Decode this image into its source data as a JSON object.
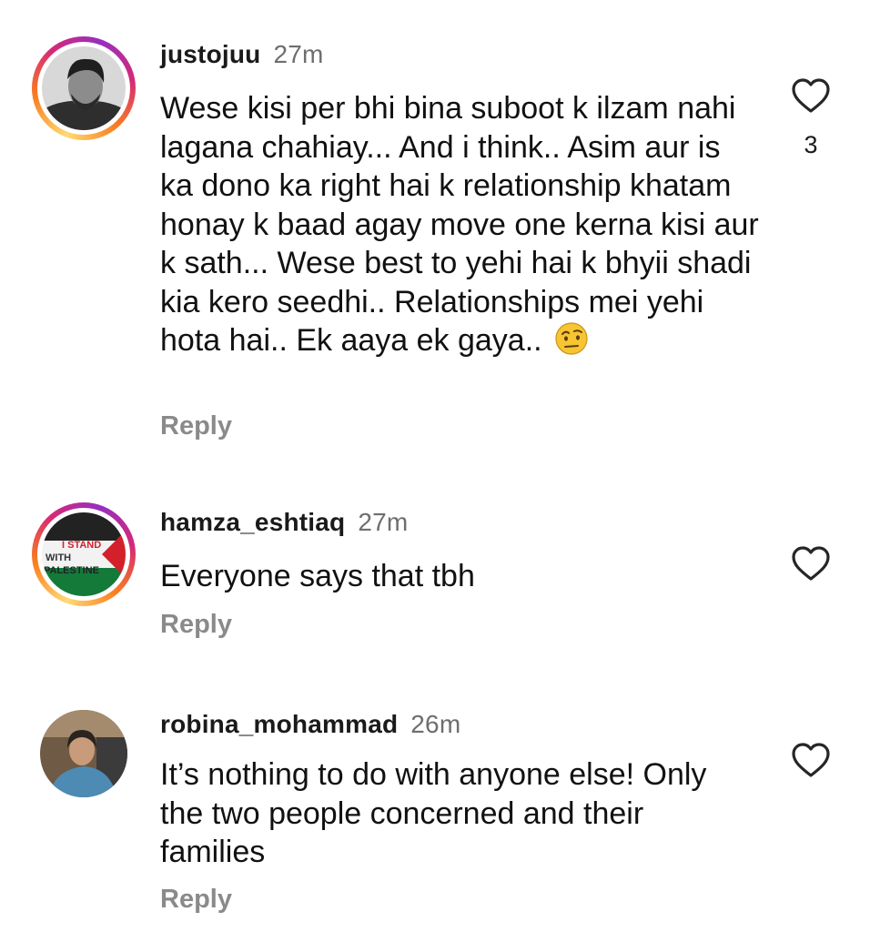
{
  "comments": [
    {
      "username": "justojuu",
      "time": "27m",
      "text": "Wese kisi per bhi bina suboot k ilzam nahi lagana chahiay... And i think.. Asim aur is ka dono ka right hai k relationship khatam honay k baad agay move one kerna kisi aur k sath... Wese best to yehi hai k bhyii shadi kia kero seedhi.. Relationships mei yehi hota hai.. Ek aaya ek gaya..",
      "emoji": "face-with-raised-eyebrow",
      "likes": "3",
      "reply_label": "Reply",
      "avatar": "man-portrait",
      "has_story_ring": true
    },
    {
      "username": "hamza_eshtiaq",
      "time": "27m",
      "text": "Everyone says that tbh",
      "reply_label": "Reply",
      "avatar_text": {
        "line1": "I STAND",
        "line2": "WITH",
        "line3": "PALESTINE"
      },
      "has_story_ring": true
    },
    {
      "username": "robina_mohammad",
      "time": "26m",
      "text": "It’s nothing to do with anyone else! Only the two people concerned and their families",
      "reply_label": "Reply",
      "avatar": "woman-portrait",
      "has_story_ring": false
    }
  ],
  "icons": {
    "like": "heart-outline-icon"
  },
  "colors": {
    "username": "#1a1a1a",
    "time": "#6e6e6e",
    "reply": "#8a8a8a",
    "heart": "#262626"
  }
}
